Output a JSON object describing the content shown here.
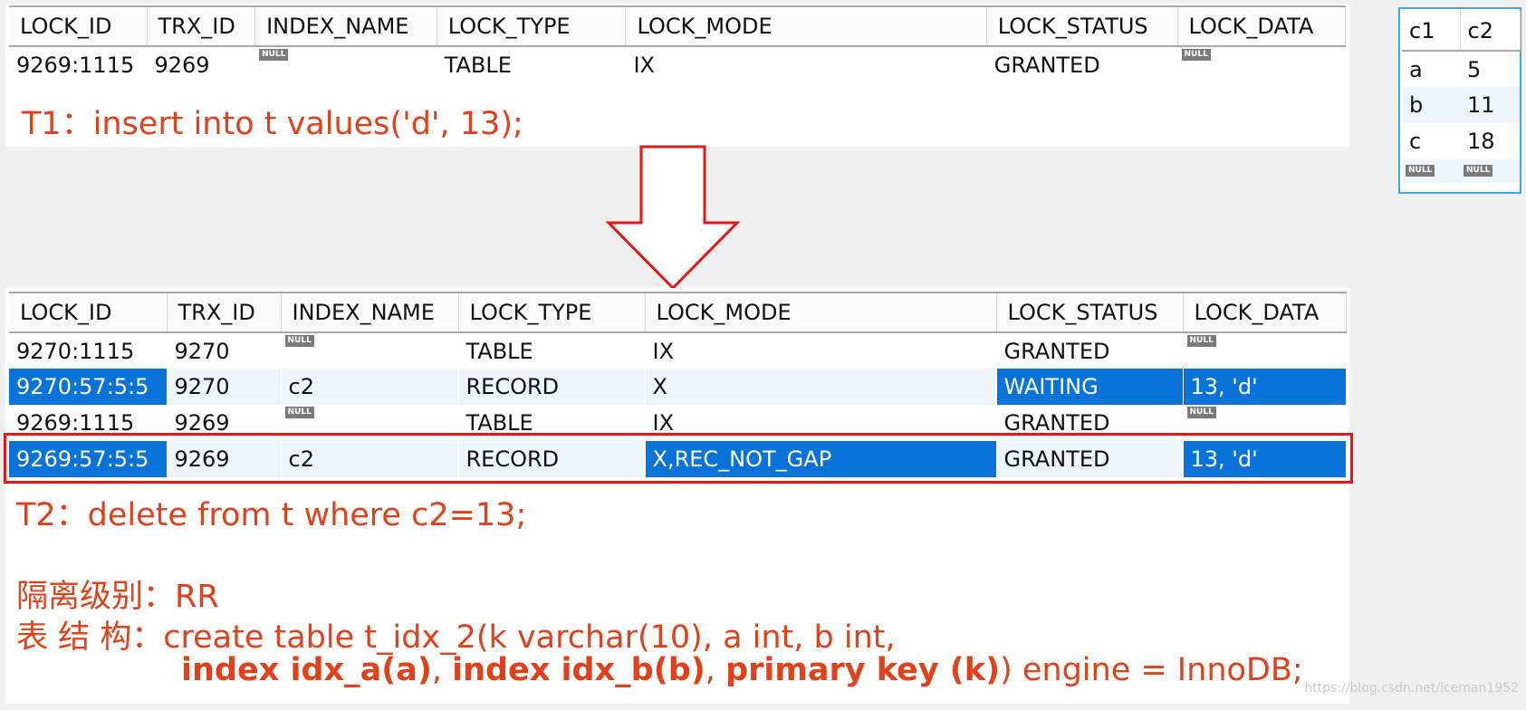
{
  "null_label": "NULL",
  "columns": [
    "LOCK_ID",
    "TRX_ID",
    "INDEX_NAME",
    "LOCK_TYPE",
    "LOCK_MODE",
    "LOCK_STATUS",
    "LOCK_DATA"
  ],
  "top_grid": {
    "rows": [
      {
        "lock_id": "9269:1115",
        "trx_id": "9269",
        "index_name": null,
        "lock_type": "TABLE",
        "lock_mode": "IX",
        "lock_status": "GRANTED",
        "lock_data": null
      }
    ]
  },
  "t1_caption": "T1：insert into t values('d', 13);",
  "bottom_grid": {
    "rows": [
      {
        "lock_id": "9270:1115",
        "trx_id": "9270",
        "index_name": null,
        "lock_type": "TABLE",
        "lock_mode": "IX",
        "lock_status": "GRANTED",
        "lock_data": null
      },
      {
        "lock_id": "9270:57:5:5",
        "trx_id": "9270",
        "index_name": "c2",
        "lock_type": "RECORD",
        "lock_mode": "X",
        "lock_status": "WAITING",
        "lock_data": "13, 'd'"
      },
      {
        "lock_id": "9269:1115",
        "trx_id": "9269",
        "index_name": null,
        "lock_type": "TABLE",
        "lock_mode": "IX",
        "lock_status": "GRANTED",
        "lock_data": null
      },
      {
        "lock_id": "9269:57:5:5",
        "trx_id": "9269",
        "index_name": "c2",
        "lock_type": "RECORD",
        "lock_mode": "X,REC_NOT_GAP",
        "lock_status": "GRANTED",
        "lock_data": "13, 'd'"
      }
    ]
  },
  "t2_caption": "T2：delete from t where c2=13;",
  "isolation_caption": "隔离级别：RR",
  "structure_caption": {
    "line1": "表 结 构：create table t_idx_2(k varchar(10), a int, b int,",
    "bold1": "index idx_a(a)",
    "sep1": ", ",
    "bold2": "index idx_b(b)",
    "sep2": ", ",
    "bold3": "primary key (k)",
    "tail": ") engine = InnoDB;"
  },
  "mini_table": {
    "columns": [
      "c1",
      "c2"
    ],
    "rows": [
      [
        "a",
        "5"
      ],
      [
        "b",
        "11"
      ],
      [
        "c",
        "18"
      ]
    ]
  },
  "watermark": "https://blog.csdn.net/iceman1952",
  "colors": {
    "caption": "#e0401a",
    "selection": "#0a73d9",
    "highlight_box": "#e51616",
    "arrow": "#e51616",
    "mini_border": "#3fa9e0"
  }
}
